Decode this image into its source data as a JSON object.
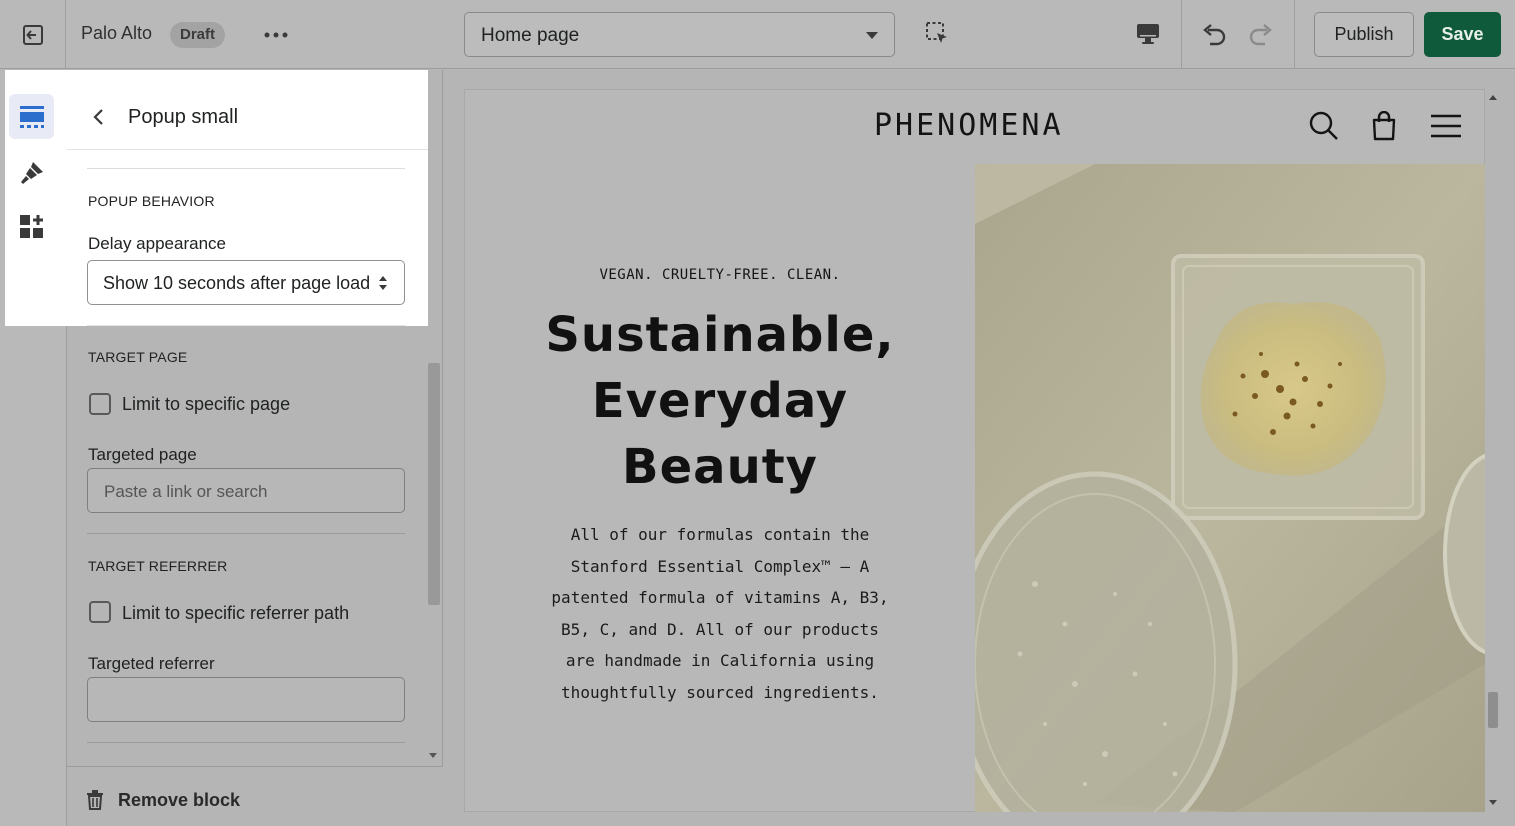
{
  "topbar": {
    "store_name": "Palo Alto",
    "status_badge": "Draft",
    "page_selector": "Home page",
    "publish_label": "Publish",
    "save_label": "Save"
  },
  "rail": {
    "items": [
      {
        "icon": "sections-icon",
        "active": true
      },
      {
        "icon": "theme-settings-icon",
        "active": false
      },
      {
        "icon": "apps-icon",
        "active": false
      }
    ]
  },
  "panel": {
    "title": "Popup small",
    "popup_behavior": {
      "heading": "POPUP BEHAVIOR",
      "delay_label": "Delay appearance",
      "delay_value": "Show 10 seconds after page load"
    },
    "target_page": {
      "heading": "TARGET PAGE",
      "checkbox_label": "Limit to specific page",
      "checked": false,
      "input_label": "Targeted page",
      "input_placeholder": "Paste a link or search"
    },
    "target_referrer": {
      "heading": "TARGET REFERRER",
      "checkbox_label": "Limit to specific referrer path",
      "checked": false,
      "input_label": "Targeted referrer",
      "input_value": ""
    },
    "remove_label": "Remove block"
  },
  "preview": {
    "brand": "PHENOMENA",
    "eyebrow": "VEGAN. CRUELTY-FREE. CLEAN.",
    "headline_lines": [
      "Sustainable,",
      "Everyday",
      "Beauty"
    ],
    "body_lines": [
      "All of our formulas contain the",
      "Stanford Essential Complex™ – A",
      "patented formula of vitamins A, B3,",
      "B5, C, and D. All of our products",
      "are handmade in California using",
      "thoughtfully sourced ingredients."
    ]
  },
  "colors": {
    "accent_green": "#0e5a3a",
    "overlay_gray": "#b5b5b5",
    "active_rail_blue": "#2c6ecb"
  }
}
